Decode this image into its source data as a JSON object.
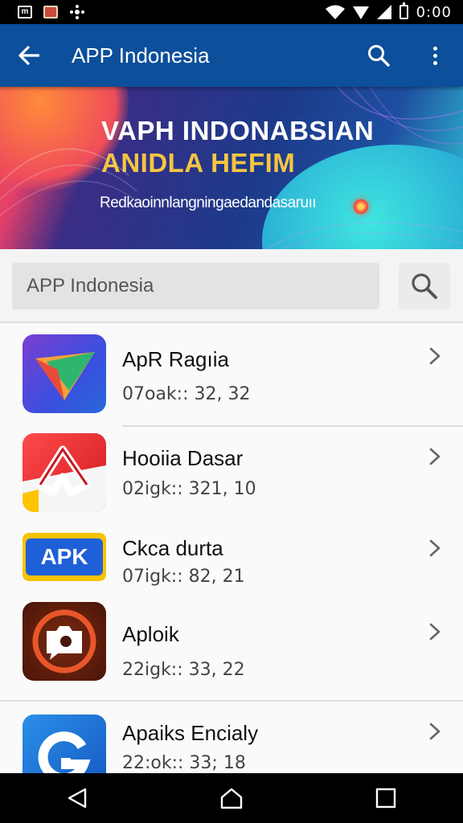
{
  "status_bar": {
    "time": "0:00",
    "left_icons": [
      "m",
      "notification-icon",
      "settings-icon"
    ],
    "right_icons": [
      "wifi-icon",
      "signal-icon",
      "signal-icon",
      "battery-icon"
    ]
  },
  "app_bar": {
    "title": "APP Indonesia",
    "color": "#0c4f9a"
  },
  "banner": {
    "title_line1": "VAPH INDONABSIAN",
    "title_line2": "ANIDLA HEFIM",
    "subtitle": "Redkaoinnlangningaedandasaruıı",
    "accent": "#f5c542"
  },
  "search": {
    "value": "APP Indonesia",
    "placeholder": "APP Indonesia"
  },
  "apps": [
    {
      "name": "ApR Ragıia",
      "meta": "07oak:: 32, 32",
      "icon": "triangle-logo-icon"
    },
    {
      "name": "Hooiia Dasar",
      "meta": "02igk:: 321, 10",
      "icon": "a-letter-logo-icon"
    },
    {
      "name": "Ckca durta",
      "meta": "07igk:: 82, 21",
      "icon": "apk-badge-icon",
      "icon_text": "APK"
    },
    {
      "name": "Aploik",
      "meta": "22igk:: 33, 22",
      "icon": "camera-logo-icon"
    },
    {
      "name": "Apaiks Encialy",
      "meta": "22:ok:: 33; 18",
      "icon": "g-letter-logo-icon"
    }
  ],
  "nav": {
    "items": [
      "back-icon",
      "home-icon",
      "recents-icon"
    ]
  }
}
